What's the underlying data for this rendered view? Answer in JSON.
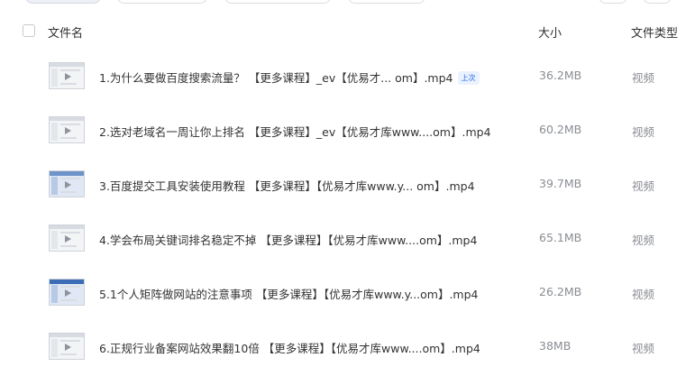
{
  "header": {
    "name_label": "文件名",
    "size_label": "大小",
    "type_label": "文件类型"
  },
  "rows": [
    {
      "name": "1.为什么要做百度搜索流量？ 【更多课程】_ev【优易才...  om】.mp4",
      "badge": "上次",
      "size": "36.2MB",
      "type": "视频"
    },
    {
      "name": "2.选对老域名一周让你上排名 【更多课程】_ev【优易才库www....om】.mp4",
      "size": "60.2MB",
      "type": "视频"
    },
    {
      "name": "3.百度提交工具安装使用教程 【更多课程】【优易才库www.y...  om】.mp4",
      "size": "39.7MB",
      "type": "视频"
    },
    {
      "name": "4.学会布局关键词排名稳定不掉 【更多课程】【优易才库www....om】.mp4",
      "size": "65.1MB",
      "type": "视频"
    },
    {
      "name": "5.1个人矩阵做网站的注意事项 【更多课程】【优易才库www.y...om】.mp4",
      "size": "26.2MB",
      "type": "视频"
    },
    {
      "name": "6.正规行业备案网站效果翻10倍 【更多课程】【优易才库www....om】.mp4",
      "size": "38MB",
      "type": "视频"
    }
  ]
}
